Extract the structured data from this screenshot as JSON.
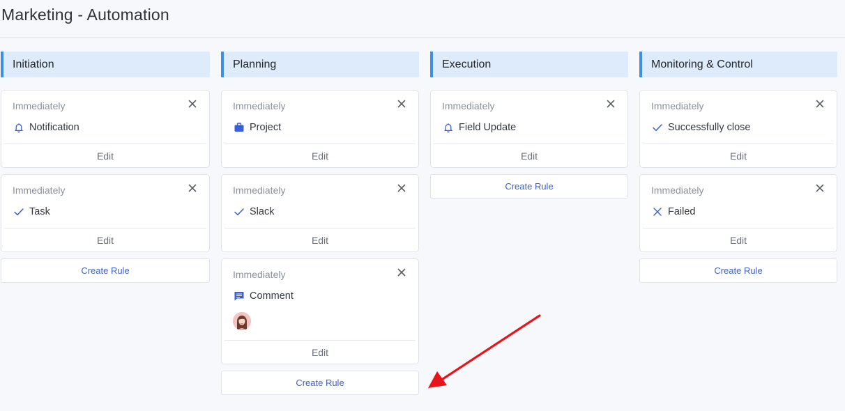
{
  "page": {
    "title": "Marketing - Automation"
  },
  "colors": {
    "accent": "#3d8fe0",
    "header_bg": "#deebfa",
    "link": "#3e62c9",
    "icon_blue": "#3b5fd6",
    "annotation_arrow": "#e8141a"
  },
  "columns": [
    {
      "title": "Initiation",
      "create_label": "Create Rule",
      "cards": [
        {
          "timing": "Immediately",
          "icon": "bell-icon",
          "action": "Notification",
          "edit": "Edit"
        },
        {
          "timing": "Immediately",
          "icon": "check-icon",
          "action": "Task",
          "edit": "Edit"
        }
      ]
    },
    {
      "title": "Planning",
      "create_label": "Create Rule",
      "cards": [
        {
          "timing": "Immediately",
          "icon": "briefcase-icon",
          "action": "Project",
          "edit": "Edit"
        },
        {
          "timing": "Immediately",
          "icon": "check-icon",
          "action": "Slack",
          "edit": "Edit"
        },
        {
          "timing": "Immediately",
          "icon": "comment-icon",
          "action": "Comment",
          "edit": "Edit",
          "avatar": true
        }
      ]
    },
    {
      "title": "Execution",
      "create_label": "Create Rule",
      "cards": [
        {
          "timing": "Immediately",
          "icon": "bell-icon",
          "action": "Field Update",
          "edit": "Edit"
        }
      ]
    },
    {
      "title": "Monitoring & Control",
      "create_label": "Create Rule",
      "cards": [
        {
          "timing": "Immediately",
          "icon": "check-icon",
          "action": "Successfully close",
          "edit": "Edit"
        },
        {
          "timing": "Immediately",
          "icon": "x-icon",
          "action": "Failed",
          "edit": "Edit"
        }
      ]
    }
  ]
}
